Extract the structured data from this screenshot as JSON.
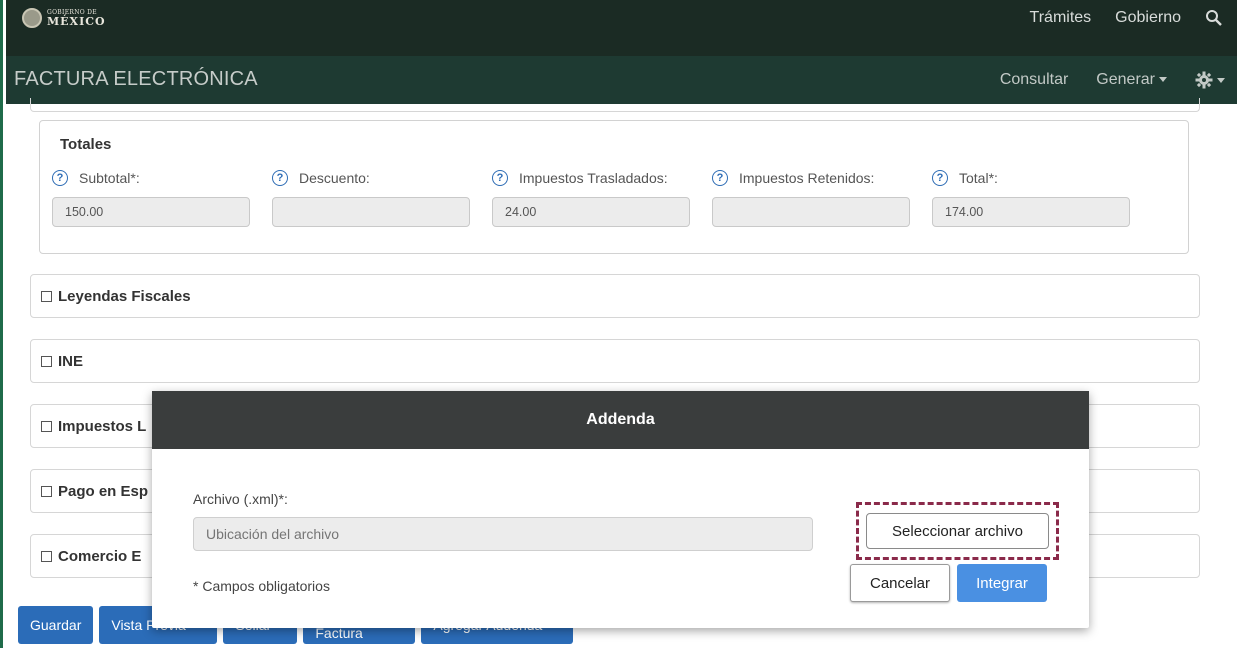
{
  "gov_bar": {
    "logo_small": "GOBIERNO DE",
    "logo_big": "MÉXICO",
    "nav": [
      "Trámites",
      "Gobierno"
    ],
    "search_icon": "search-icon"
  },
  "app_header": {
    "title": "FACTURA ELECTRÓNICA",
    "consultar": "Consultar",
    "generar": "Generar",
    "settings_icon": "gear-icon"
  },
  "totales": {
    "title": "Totales",
    "fields": [
      {
        "label": "Subtotal*:",
        "value": "150.00"
      },
      {
        "label": "Descuento:",
        "value": ""
      },
      {
        "label": "Impuestos Trasladados:",
        "value": "24.00"
      },
      {
        "label": "Impuestos Retenidos:",
        "value": ""
      },
      {
        "label": "Total*:",
        "value": "174.00"
      }
    ]
  },
  "sections": [
    "Leyendas Fiscales",
    "INE",
    "Impuestos L",
    "Pago en Esp",
    "Comercio E"
  ],
  "bottom_buttons": [
    "Guardar",
    "Vista Previa",
    "Sellar",
    "Nueva Factura",
    "Agregar Addenda"
  ],
  "modal": {
    "title": "Addenda",
    "file_label": "Archivo (.xml)*:",
    "file_placeholder": "Ubicación del archivo",
    "required_note": "* Campos obligatorios",
    "select_button": "Seleccionar archivo",
    "cancel_button": "Cancelar",
    "integrate_button": "Integrar",
    "highlight_color": "#8a2a4a"
  },
  "colors": {
    "gov_bar": "#1b2b24",
    "app_bar": "#1e3a32",
    "primary_blue": "#2b6cb8",
    "modal_header": "#3a3d3d"
  }
}
